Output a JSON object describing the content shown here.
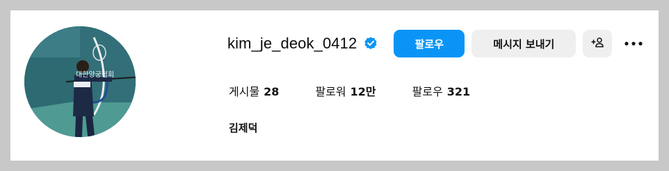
{
  "profile": {
    "username": "kim_je_deok_0412",
    "verified": true,
    "full_name": "김제덕",
    "avatar": "archer-photo"
  },
  "actions": {
    "follow_label": "팔로우",
    "message_label": "메시지 보내기",
    "add_user_icon": "add-person-icon",
    "more_icon": "more-options-icon"
  },
  "stats": {
    "posts_label": "게시물",
    "posts_value": "28",
    "followers_label": "팔로워",
    "followers_value": "12만",
    "following_label": "팔로우",
    "following_value": "321"
  },
  "colors": {
    "accent": "#0a95f6",
    "secondary_button": "#efefef",
    "verified_badge": "#0a95f6"
  }
}
